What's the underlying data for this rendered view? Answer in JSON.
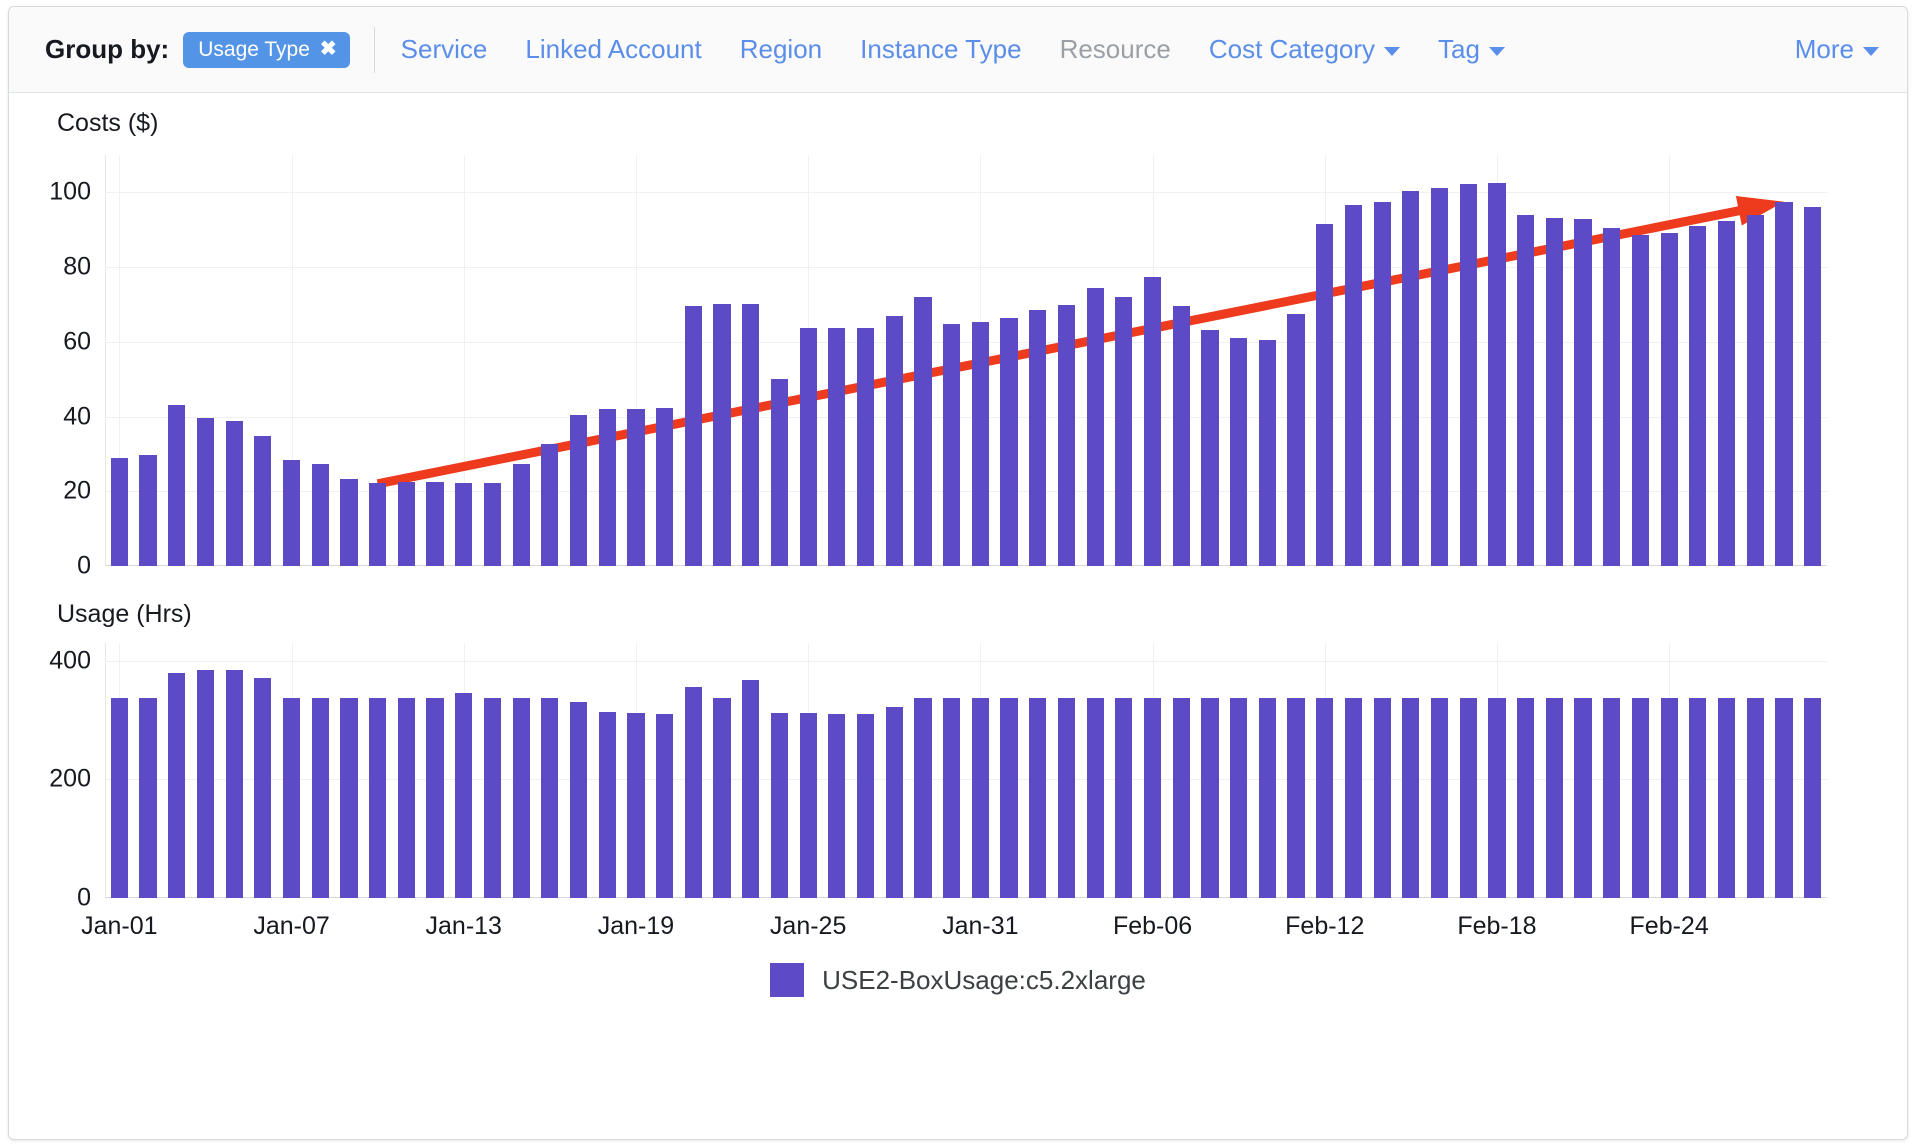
{
  "toolbar": {
    "group_by_label": "Group by:",
    "active_chip": {
      "label": "Usage Type",
      "remove_icon": "✖"
    },
    "options": [
      {
        "label": "Service",
        "disabled": false,
        "has_caret": false
      },
      {
        "label": "Linked Account",
        "disabled": false,
        "has_caret": false
      },
      {
        "label": "Region",
        "disabled": false,
        "has_caret": false
      },
      {
        "label": "Instance Type",
        "disabled": false,
        "has_caret": false
      },
      {
        "label": "Resource",
        "disabled": true,
        "has_caret": false
      },
      {
        "label": "Cost Category",
        "disabled": false,
        "has_caret": true
      },
      {
        "label": "Tag",
        "disabled": false,
        "has_caret": true
      }
    ],
    "more": {
      "label": "More",
      "has_caret": true
    }
  },
  "legend": {
    "items": [
      {
        "label": "USE2-BoxUsage:c5.2xlarge",
        "color": "#5d4ac5"
      }
    ]
  },
  "colors": {
    "bar": "#5d4ac5",
    "trend": "#ee3b1e",
    "chip": "#5494e6",
    "link": "#5b8dea",
    "disabled_link": "#9aa0a6",
    "grid": "#f0f0f0"
  },
  "chart_data": [
    {
      "id": "costs",
      "type": "bar",
      "title": "Costs ($)",
      "xlabel": "",
      "ylabel": "Costs ($)",
      "ylim": [
        0,
        110
      ],
      "yticks": [
        0,
        20,
        40,
        60,
        80,
        100
      ],
      "grid": true,
      "legend_position": "bottom",
      "series_name": "USE2-BoxUsage:c5.2xlarge",
      "color": "#5d4ac5",
      "categories": [
        "Jan-01",
        "Jan-02",
        "Jan-03",
        "Jan-04",
        "Jan-05",
        "Jan-06",
        "Jan-07",
        "Jan-08",
        "Jan-09",
        "Jan-10",
        "Jan-11",
        "Jan-12",
        "Jan-13",
        "Jan-14",
        "Jan-15",
        "Jan-16",
        "Jan-17",
        "Jan-18",
        "Jan-19",
        "Jan-20",
        "Jan-21",
        "Jan-22",
        "Jan-23",
        "Jan-24",
        "Jan-25",
        "Jan-26",
        "Jan-27",
        "Jan-28",
        "Jan-29",
        "Jan-30",
        "Jan-31",
        "Feb-01",
        "Feb-02",
        "Feb-03",
        "Feb-04",
        "Feb-05",
        "Feb-06",
        "Feb-07",
        "Feb-08",
        "Feb-09",
        "Feb-10",
        "Feb-11",
        "Feb-12",
        "Feb-13",
        "Feb-14",
        "Feb-15",
        "Feb-16",
        "Feb-17",
        "Feb-18",
        "Feb-19",
        "Feb-20",
        "Feb-21",
        "Feb-22",
        "Feb-23",
        "Feb-24",
        "Feb-25",
        "Feb-26",
        "Feb-27",
        "Feb-28",
        "Mar-01"
      ],
      "xticks": [
        "Jan-01",
        "Jan-07",
        "Jan-13",
        "Jan-19",
        "Jan-25",
        "Jan-31",
        "Feb-06",
        "Feb-12",
        "Feb-18",
        "Feb-24"
      ],
      "xtick_indices": [
        0,
        6,
        12,
        18,
        24,
        30,
        36,
        42,
        48,
        54
      ],
      "values": [
        29,
        29.8,
        43,
        39.5,
        38.8,
        34.8,
        28.5,
        27.4,
        23.2,
        22.2,
        22.4,
        22.4,
        22.3,
        22.3,
        27.4,
        32.6,
        40.5,
        42,
        42,
        42.3,
        69.7,
        70,
        70.2,
        50,
        63.8,
        63.8,
        63.8,
        66.8,
        72,
        64.7,
        65.3,
        66.3,
        68.6,
        69.8,
        74.5,
        72,
        77.3,
        69.6,
        63.2,
        61,
        60.6,
        67.5,
        91.5,
        96.6,
        97.4,
        100.5,
        101.3,
        102.3,
        102.6,
        94,
        93.2,
        93,
        90.6,
        88.6,
        89.2,
        91,
        92.4,
        94,
        97.5,
        96
      ],
      "annotations": [
        {
          "type": "trend-arrow",
          "color": "#ee3b1e",
          "from": {
            "index": 9,
            "value": 22
          },
          "to": {
            "index": 58,
            "value": 97.5
          }
        }
      ]
    },
    {
      "id": "usage",
      "type": "bar",
      "title": "Usage (Hrs)",
      "xlabel": "",
      "ylabel": "Usage (Hrs)",
      "ylim": [
        0,
        430
      ],
      "yticks": [
        0,
        200,
        400
      ],
      "grid": true,
      "series_name": "USE2-BoxUsage:c5.2xlarge",
      "color": "#5d4ac5",
      "categories": [
        "Jan-01",
        "Jan-02",
        "Jan-03",
        "Jan-04",
        "Jan-05",
        "Jan-06",
        "Jan-07",
        "Jan-08",
        "Jan-09",
        "Jan-10",
        "Jan-11",
        "Jan-12",
        "Jan-13",
        "Jan-14",
        "Jan-15",
        "Jan-16",
        "Jan-17",
        "Jan-18",
        "Jan-19",
        "Jan-20",
        "Jan-21",
        "Jan-22",
        "Jan-23",
        "Jan-24",
        "Jan-25",
        "Jan-26",
        "Jan-27",
        "Jan-28",
        "Jan-29",
        "Jan-30",
        "Jan-31",
        "Feb-01",
        "Feb-02",
        "Feb-03",
        "Feb-04",
        "Feb-05",
        "Feb-06",
        "Feb-07",
        "Feb-08",
        "Feb-09",
        "Feb-10",
        "Feb-11",
        "Feb-12",
        "Feb-13",
        "Feb-14",
        "Feb-15",
        "Feb-16",
        "Feb-17",
        "Feb-18",
        "Feb-19",
        "Feb-20",
        "Feb-21",
        "Feb-22",
        "Feb-23",
        "Feb-24",
        "Feb-25",
        "Feb-26",
        "Feb-27",
        "Feb-28",
        "Mar-01"
      ],
      "xticks": [
        "Jan-01",
        "Jan-07",
        "Jan-13",
        "Jan-19",
        "Jan-25",
        "Jan-31",
        "Feb-06",
        "Feb-12",
        "Feb-18",
        "Feb-24"
      ],
      "xtick_indices": [
        0,
        6,
        12,
        18,
        24,
        30,
        36,
        42,
        48,
        54
      ],
      "values": [
        337,
        337,
        379,
        384,
        385,
        371,
        338,
        337,
        337,
        337,
        337,
        337,
        345,
        337,
        337,
        337,
        331,
        313,
        312,
        311,
        355,
        337,
        367,
        312,
        312,
        311,
        311,
        322,
        337,
        337,
        337,
        337,
        337,
        337,
        337,
        337,
        337,
        337,
        337,
        337,
        337,
        337,
        337,
        337,
        337,
        337,
        337,
        337,
        337,
        337,
        337,
        337,
        337,
        337,
        337,
        337,
        337,
        337,
        337,
        337
      ]
    }
  ]
}
